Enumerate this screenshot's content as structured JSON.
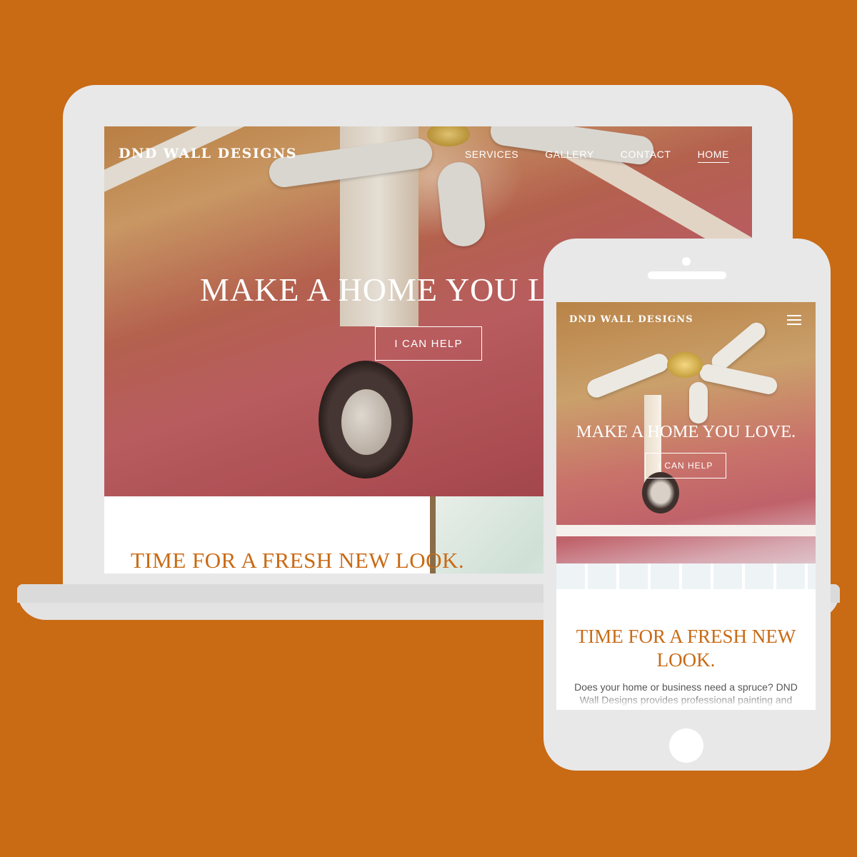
{
  "colors": {
    "background": "#c96a14",
    "accent": "#c96a14",
    "device": "#e8e8e8"
  },
  "desktop": {
    "logo": "DND WALL DESIGNS",
    "nav": [
      {
        "label": "SERVICES",
        "active": false
      },
      {
        "label": "GALLERY",
        "active": false
      },
      {
        "label": "CONTACT",
        "active": false
      },
      {
        "label": "HOME",
        "active": true
      }
    ],
    "headline": "MAKE A HOME YOU LOVE.",
    "cta": "I CAN HELP",
    "section_title": "TIME FOR A FRESH NEW LOOK."
  },
  "mobile": {
    "logo": "DND WALL DESIGNS",
    "menu_icon": "hamburger-menu-icon",
    "headline": "MAKE A HOME YOU LOVE.",
    "cta": "I CAN HELP",
    "section_title": "TIME FOR A FRESH NEW LOOK.",
    "body": "Does your home or business need a spruce? DND Wall Designs provides professional painting and wall covering for both residential"
  }
}
